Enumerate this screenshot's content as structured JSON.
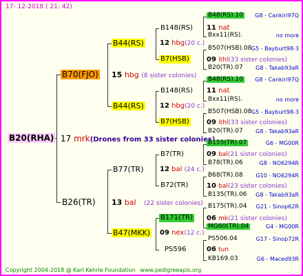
{
  "header": {
    "date": "17-  12-2018  (  21:  42)"
  },
  "footer": {
    "copyright": "Copyright 2004-2018 @ Karl Kehrle Foundation",
    "site": "www.pedigreeapis.org"
  },
  "root": {
    "id": "B20(RHA)",
    "gen": "17",
    "sym": "mrk",
    "note": "(Drones from 33 sister colonies)"
  },
  "g1": {
    "a": {
      "id": "B70(FJO)",
      "gen": "15",
      "sym": "hbg",
      "note": "(8 sister colonies)"
    },
    "b": {
      "id": "B26(TR)",
      "gen": "13",
      "sym": "bal",
      "note": "(22 sister colonies)"
    }
  },
  "g2": {
    "aa": {
      "id": "B44(RS)",
      "gen": "12",
      "sym": "hbg",
      "note": "(20 c.)"
    },
    "ab": {
      "id": "B44(RS)",
      "gen": "12",
      "sym": "hbg",
      "note": "(20 c.)"
    },
    "ba": {
      "id": "B77(TR)",
      "gen": "12",
      "sym": "bal",
      "note": "(24 c.)"
    },
    "bb": {
      "id": "B47(MKK)",
      "gen": "09",
      "sym": "nex",
      "note": "(12 c.)"
    }
  },
  "g3": {
    "aaa": {
      "id": "B148(RS)",
      "gen": "11",
      "sym": "nat"
    },
    "aab": {
      "id": "B7(HSB)",
      "gen": "09",
      "sym": "ithl",
      "note": "(33 sister colonies)"
    },
    "aba": {
      "id": "B148(RS)",
      "gen": "11",
      "sym": "nat"
    },
    "abb": {
      "id": "B7(HSB)",
      "gen": "09",
      "sym": "ithl",
      "note": "(33 sister colonies)"
    },
    "baa": {
      "id": "B7(TR)",
      "gen": "09",
      "sym": "bal",
      "note": "(21 sister colonies)"
    },
    "bab": {
      "id": "B72(TR)",
      "gen": "10",
      "sym": "bal",
      "note": "(23 sister colonies)"
    },
    "bba": {
      "id": "B171(TR)",
      "gen": "06",
      "sym": "mk",
      "note": "(21 sister colonies)"
    },
    "bbb": {
      "id": "PS596",
      "gen": "06",
      "sym": "tun"
    }
  },
  "g4": [
    {
      "id": "B48(RS).10",
      "loc": "G8 - Cankiri97Q",
      "green": true
    },
    {
      "id": "Bxx11(RS).",
      "loc": "no more",
      "green": false
    },
    {
      "id": "B507(HSB).08",
      "loc": "G5 - Bayburt98-3",
      "green": false
    },
    {
      "id": "B20(TR).07",
      "loc": "G8 - Takab93aR",
      "green": false
    },
    {
      "id": "B48(RS).10",
      "loc": "G8 - Cankiri97Q",
      "green": true
    },
    {
      "id": "Bxx11(RS).",
      "loc": "no more",
      "green": false
    },
    {
      "id": "B507(HSB).08",
      "loc": "G5 - Bayburt98-3",
      "green": false
    },
    {
      "id": "B20(TR).07",
      "loc": "G8 - Takab93aR",
      "green": false
    },
    {
      "id": "B155(TR).07",
      "loc": "G6 - MG00R",
      "green": true
    },
    {
      "id": "B78(TR).06",
      "loc": "G8 - NO6294R",
      "green": false
    },
    {
      "id": "B68(TR).08",
      "loc": "G10 - NO6294R",
      "green": false
    },
    {
      "id": "B135(TR).06",
      "loc": "G8 - Takab93aR",
      "green": false
    },
    {
      "id": "B175(TR).04",
      "loc": "G21 - Sinop62R",
      "green": false
    },
    {
      "id": "MG60(TR).04",
      "loc": "G4 - MG00R",
      "green": true
    },
    {
      "id": "PS506.04",
      "loc": "G17 - Sinop72R",
      "green": false
    },
    {
      "id": "KB169.03",
      "loc": "G6 - Maced93R",
      "green": false
    }
  ],
  "colors": {
    "border": "#ff00ff",
    "background": "#fffff0",
    "highlight_yellow": "#ffff00",
    "highlight_green": "#33cc33",
    "highlight_orange": "#ff9900",
    "header_text": "#cc00cc",
    "footer_text": "#008800"
  }
}
